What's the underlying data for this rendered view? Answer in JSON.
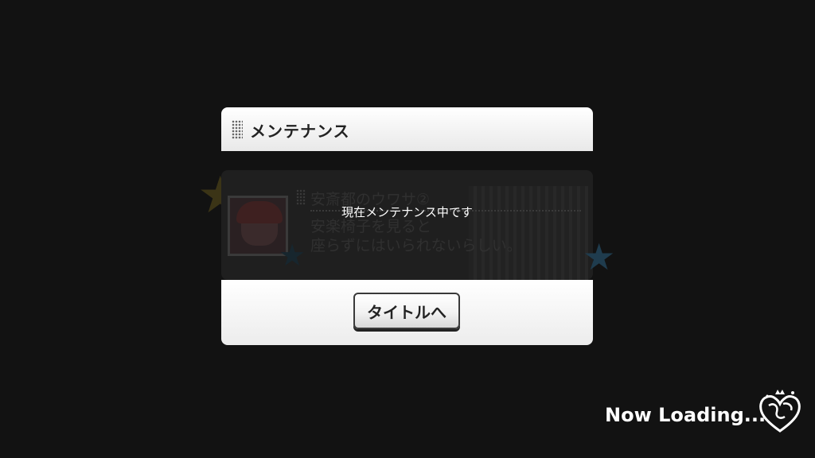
{
  "background_card": {
    "title": "安斎都のウワサ②",
    "line1": "安楽椅子を見ると",
    "line2": "座らずにはいられないらしい。"
  },
  "modal": {
    "title": "メンテナンス",
    "message": "現在メンテナンス中です",
    "button_label": "タイトルへ"
  },
  "loading": {
    "text": "Now Loading..."
  },
  "icons": {
    "header": "dotted-grip-icon",
    "logo": "heart-crown-logo-icon"
  },
  "colors": {
    "background": "#121212",
    "modal_panel": "#ffffff",
    "text_dark": "#222222",
    "text_light": "#ffffff"
  }
}
